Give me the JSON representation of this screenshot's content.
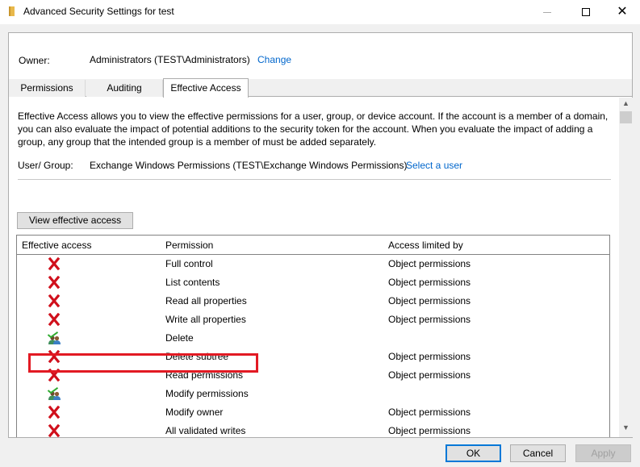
{
  "window": {
    "title": "Advanced Security Settings for test",
    "icon": "folder-icon",
    "controls": [
      "minimize",
      "maximize",
      "close"
    ]
  },
  "owner": {
    "label": "Owner:",
    "value": "Administrators (TEST\\Administrators)",
    "change_link": "Change"
  },
  "tabs": [
    {
      "label": "Permissions",
      "active": false
    },
    {
      "label": "Auditing",
      "active": false
    },
    {
      "label": "Effective Access",
      "active": true
    }
  ],
  "effective_access": {
    "description": "Effective Access allows you to view the effective permissions for a user, group, or device account. If the account is a member of a domain, you can also evaluate the impact of potential additions to the security token for the account. When you evaluate the impact of adding a group, any group that the intended group is a member of must be added separately.",
    "user_group_label": "User/ Group:",
    "user_group_value": "Exchange Windows Permissions (TEST\\Exchange Windows Permissions)",
    "select_user_link": "Select a user",
    "view_button": "View effective access",
    "columns": [
      "Effective access",
      "Permission",
      "Access limited by"
    ],
    "rows": [
      {
        "access": "denied",
        "icon": "red-x-icon",
        "permission": "Full control",
        "limited_by": "Object permissions"
      },
      {
        "access": "denied",
        "icon": "red-x-icon",
        "permission": "List contents",
        "limited_by": "Object permissions"
      },
      {
        "access": "denied",
        "icon": "red-x-icon",
        "permission": "Read all properties",
        "limited_by": "Object permissions"
      },
      {
        "access": "denied",
        "icon": "red-x-icon",
        "permission": "Write all properties",
        "limited_by": "Object permissions"
      },
      {
        "access": "allowed",
        "icon": "users-check-icon",
        "permission": "Delete",
        "limited_by": ""
      },
      {
        "access": "denied",
        "icon": "red-x-icon",
        "permission": "Delete subtree",
        "limited_by": "Object permissions"
      },
      {
        "access": "denied",
        "icon": "red-x-icon",
        "permission": "Read permissions",
        "limited_by": "Object permissions"
      },
      {
        "access": "allowed",
        "icon": "users-check-icon",
        "permission": "Modify permissions",
        "limited_by": "",
        "highlighted": true
      },
      {
        "access": "denied",
        "icon": "red-x-icon",
        "permission": "Modify owner",
        "limited_by": "Object permissions"
      },
      {
        "access": "denied",
        "icon": "red-x-icon",
        "permission": "All validated writes",
        "limited_by": "Object permissions"
      }
    ]
  },
  "buttons": {
    "ok": "OK",
    "cancel": "Cancel",
    "apply": "Apply"
  },
  "colors": {
    "link": "#0066cc",
    "highlight_box": "#e21a23",
    "deny_x": "#d0101c",
    "ok_border": "#0078d7"
  }
}
